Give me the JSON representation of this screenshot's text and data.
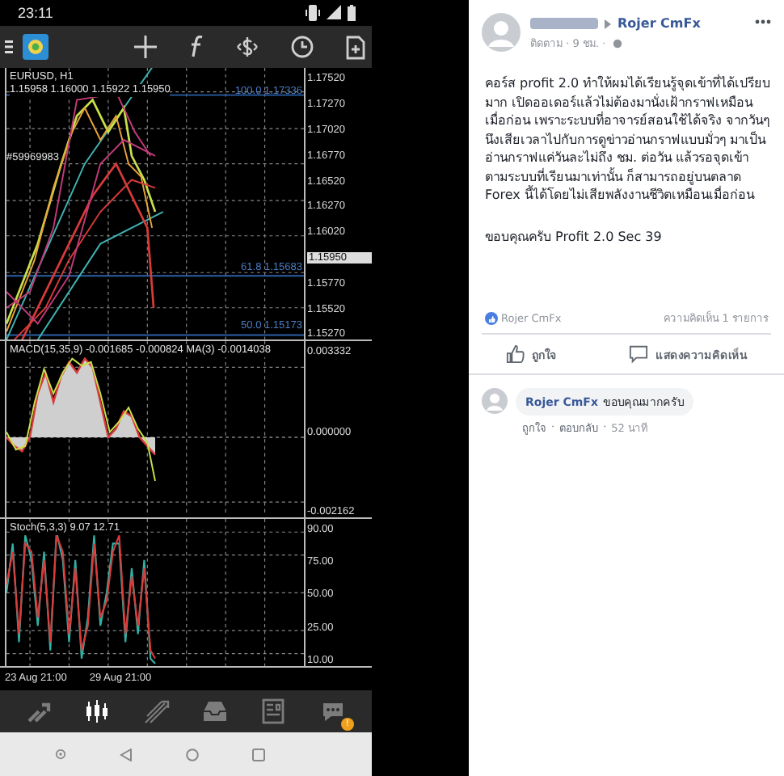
{
  "status_bar": {
    "time": "23:11"
  },
  "chart": {
    "symbol": "EURUSD, H1",
    "ohlc": "1.15958 1.16000 1.15922 1.15950",
    "order": "#59969983",
    "price_axis": [
      {
        "text": "1.17520",
        "kind": "tick"
      },
      {
        "text": "1.17270",
        "kind": "tick"
      },
      {
        "text": "1.17020",
        "kind": "tick"
      },
      {
        "text": "1.16770",
        "kind": "tick"
      },
      {
        "text": "1.16520",
        "kind": "tick"
      },
      {
        "text": "1.16270",
        "kind": "tick"
      },
      {
        "text": "1.16020",
        "kind": "tick"
      },
      {
        "text": "1.15950",
        "kind": "current"
      },
      {
        "text": "1.15770",
        "kind": "tick"
      },
      {
        "text": "1.15520",
        "kind": "tick"
      },
      {
        "text": "1.15270",
        "kind": "tick"
      }
    ],
    "fib_levels": [
      "100.0 1.17336",
      "61.8 1.15683",
      "50.0 1.15173"
    ],
    "macd": {
      "label": "MACD(15,35,9) -0.001685 -0.000824 MA(3) -0.0014038",
      "axis": [
        "0.003332",
        "0.000000",
        "-0.002162"
      ]
    },
    "stoch": {
      "label": "Stoch(5,3,3) 9.07 12.71",
      "axis": [
        "90.00",
        "75.00",
        "50.00",
        "25.00",
        "10.00"
      ]
    },
    "time_axis": [
      "23 Aug 21:00",
      "29 Aug 21:00"
    ]
  },
  "bottom_nav": [
    {
      "selected": false
    },
    {
      "selected": true
    },
    {
      "selected": false
    },
    {
      "selected": false
    },
    {
      "selected": false
    },
    {
      "selected": false,
      "badge": "!"
    }
  ],
  "post": {
    "page": "Rojer CmFx",
    "meta": "ติดตาม · 9 ชม. ·",
    "text": "คอร์ส profit 2.0 ทำให้ผมได้เรียนรู้จุดเข้าที่ได้เปรียบมาก เปิดออเดอร์แล้วไม่ต้องมานั่งเฝ้ากราฟเหมือนเมื่อก่อน เพราะระบบที่อาจารย์สอนใช้ได้จริง จากวันๆนึงเสียเวลาไปกับการดูข่าวอ่านกราฟแบบมั่วๆ มาเป็นอ่านกราฟแค่วันละไม่ถึง ชม. ต่อวัน แล้วรอจุดเข้าตามระบบที่เรียนมาเท่านั้น ก็สามารถอยู่บนตลาด Forex นี้ได้โดยไม่เสียพลังงานชีวิตเหมือนเมื่อก่อน",
    "thanks": "ขอบคุณครับ Profit 2.0 Sec 39",
    "reactions": "Rojer CmFx",
    "comment_count": "ความคิดเห็น 1 รายการ",
    "actions": [
      "ถูกใจ",
      "แสดงความคิดเห็น"
    ],
    "comment": {
      "author": "Rojer CmFx",
      "text": "ขอบคุณมากครับ",
      "like": "ถูกใจ",
      "reply": "ตอบกลับ",
      "time": "52 นาที",
      "separator": "·"
    }
  }
}
